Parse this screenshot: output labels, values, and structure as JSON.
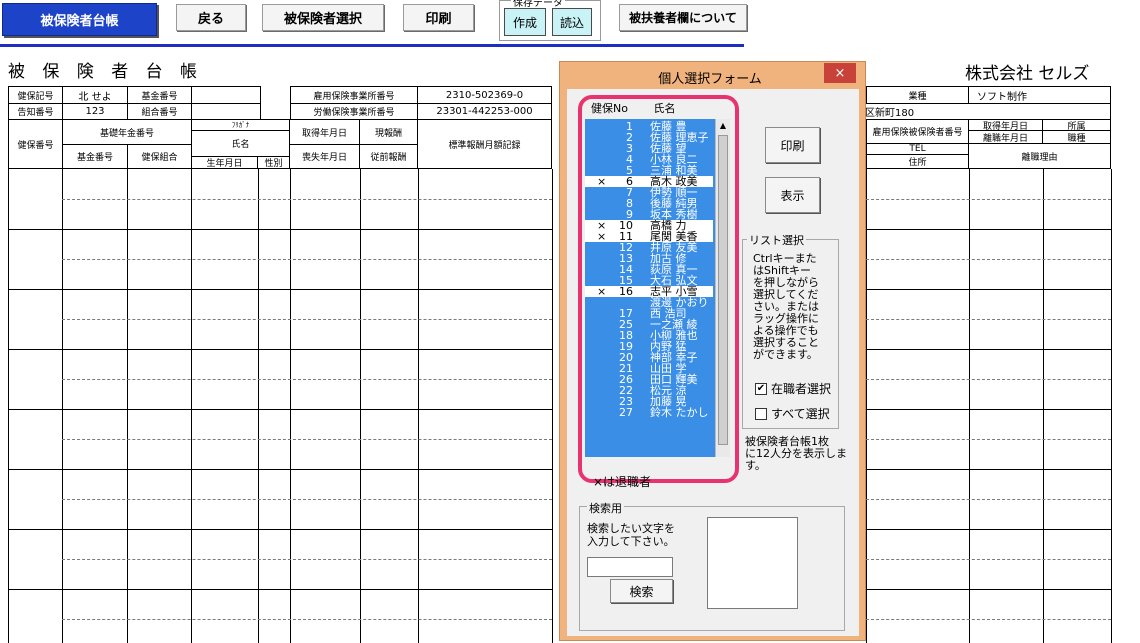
{
  "toolbar": {
    "primary": "被保険者台帳",
    "back": "戻る",
    "select": "被保険者選択",
    "print": "印刷",
    "group_title": "保存データ",
    "create": "作成",
    "load": "読込",
    "dependents": "被扶養者欄について"
  },
  "page": {
    "title": "被 保 険 者 台 帳",
    "company": "株式会社 セルズ"
  },
  "sheet": {
    "kenpo_kigo_label": "健保記号",
    "kenpo_kigo_value": "北 せよ",
    "kikin_no_label": "基金番号",
    "tsuchi_no_label": "告知番号",
    "tsuchi_no_value": "123",
    "kumiai_no_label": "組合番号",
    "koyo_label": "雇用保険事業所番号",
    "koyo_value": "2310-502369-0",
    "rodo_label": "労働保険事業所番号",
    "rodo_value": "23301-442253-000",
    "gyoshu_label": "業種",
    "gyoshu_value": "ソフト制作",
    "address_fragment": "区新町180",
    "kenpo_no": "健保番号",
    "kosei_no": "基礎年金番号",
    "kikin_no2": "基金番号",
    "kenpo_kumiai": "健保組合",
    "furigana": "ﾌﾘｶﾞﾅ",
    "shimei": "氏名",
    "seinengappi": "生年月日",
    "seibetsu": "性別",
    "shutoku": "取得年月日",
    "soshitsu": "喪失年月日",
    "genhoshu": "現報酬",
    "juzen": "従前報酬",
    "hyojun": "標準報酬月額記録",
    "koyo_hihoken": "雇用保険被保険者番号",
    "tel": "TEL",
    "jusho": "住所",
    "shutoku2": "取得年月日",
    "rishoku": "離職年月日",
    "shozoku": "所属",
    "shokushu": "職種",
    "rishoku_riyu": "離職理由"
  },
  "dialog": {
    "title": "個人選択フォーム",
    "close": "×",
    "col_no": "健保No",
    "col_name": "氏名",
    "rows": [
      {
        "mark": "",
        "no": "1",
        "name": "佐藤 豊",
        "sel": false
      },
      {
        "mark": "",
        "no": "2",
        "name": "佐藤 理恵子",
        "sel": false
      },
      {
        "mark": "",
        "no": "3",
        "name": "佐藤 望",
        "sel": false
      },
      {
        "mark": "",
        "no": "4",
        "name": "小林 良二",
        "sel": false
      },
      {
        "mark": "",
        "no": "5",
        "name": "三浦 和美",
        "sel": false
      },
      {
        "mark": "×",
        "no": "6",
        "name": "高木 政美",
        "sel": true
      },
      {
        "mark": "",
        "no": "7",
        "name": "伊勢 順一",
        "sel": false
      },
      {
        "mark": "",
        "no": "8",
        "name": "後藤 純男",
        "sel": false
      },
      {
        "mark": "",
        "no": "9",
        "name": "坂本 秀樹",
        "sel": false
      },
      {
        "mark": "×",
        "no": "10",
        "name": "高橋 力",
        "sel": true
      },
      {
        "mark": "×",
        "no": "11",
        "name": "尾関 美香",
        "sel": true
      },
      {
        "mark": "",
        "no": "12",
        "name": "井原 友美",
        "sel": false
      },
      {
        "mark": "",
        "no": "13",
        "name": "加古 修",
        "sel": false
      },
      {
        "mark": "",
        "no": "14",
        "name": "荻原 真一",
        "sel": false
      },
      {
        "mark": "",
        "no": "15",
        "name": "大石 弘文",
        "sel": false
      },
      {
        "mark": "×",
        "no": "16",
        "name": "志平 小雪",
        "sel": true
      },
      {
        "mark": "",
        "no": "",
        "name": "渡邊 かおり",
        "sel": false
      },
      {
        "mark": "",
        "no": "17",
        "name": "西 浩司",
        "sel": false
      },
      {
        "mark": "",
        "no": "25",
        "name": "一之瀬 綾",
        "sel": false
      },
      {
        "mark": "",
        "no": "18",
        "name": "小柳 雅也",
        "sel": false
      },
      {
        "mark": "",
        "no": "19",
        "name": "内野 猛",
        "sel": false
      },
      {
        "mark": "",
        "no": "20",
        "name": "神部 幸子",
        "sel": false
      },
      {
        "mark": "",
        "no": "21",
        "name": "山田 学",
        "sel": false
      },
      {
        "mark": "",
        "no": "26",
        "name": "田口 輝美",
        "sel": false
      },
      {
        "mark": "",
        "no": "22",
        "name": "松元 涼",
        "sel": false
      },
      {
        "mark": "",
        "no": "23",
        "name": "加藤 晃",
        "sel": false
      },
      {
        "mark": "",
        "no": "27",
        "name": "鈴木 たかし",
        "sel": false
      }
    ],
    "print_btn": "印刷",
    "show_btn": "表示",
    "list_select_legend": "リスト選択",
    "help_lines": [
      "Ctrlキーまた",
      "はShiftキー",
      "を押しながら",
      "選択してくだ",
      "さい。または",
      "ラッグ操作に",
      "よる操作でも",
      "選択すること",
      "ができます。"
    ],
    "chk_active": "在職者選択",
    "chk_active_checked": "✔",
    "chk_all": "すべて選択",
    "note_lines": [
      "被保険者台帳1枚",
      "に12人分を表示しま",
      "す。"
    ],
    "retired_note": "×は退職者",
    "search_legend": "検索用",
    "search_help_lines": [
      "検索したい文字を",
      "入力して下さい。"
    ],
    "search_btn": "検索"
  },
  "colors": {
    "accent": "#1d44c8",
    "list_bg": "#3b8ee6",
    "highlight": "#e8336e",
    "dialog_frame": "#f0b37d"
  }
}
